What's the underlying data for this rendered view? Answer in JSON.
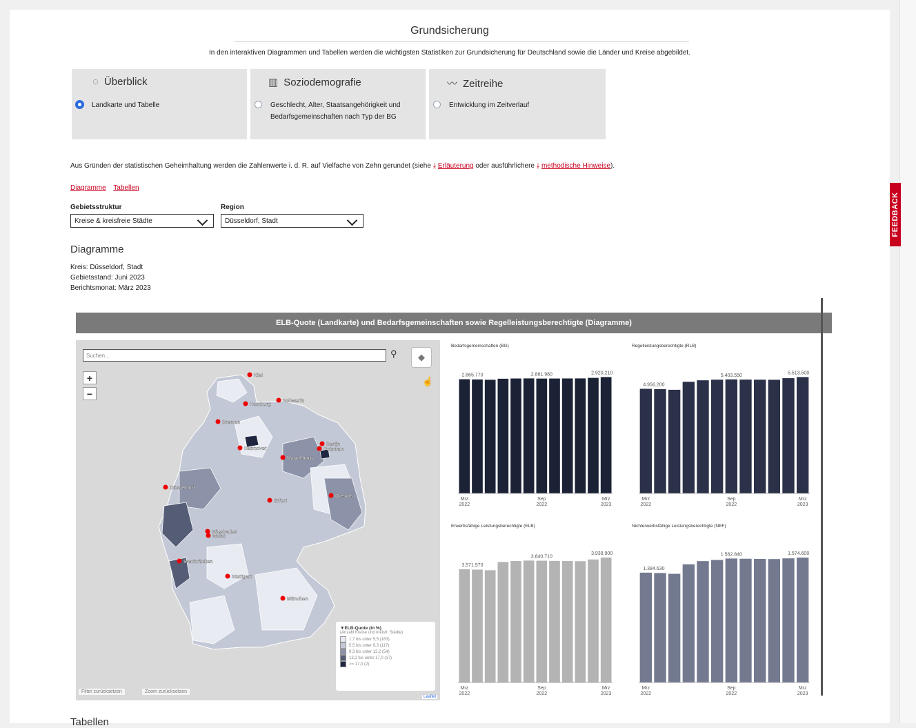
{
  "page": {
    "title": "Grundsicherung",
    "intro": "In den interaktiven Diagrammen und Tabellen werden die wichtigsten Statistiken zur Grundsicherung für Deutschland sowie die Länder und Kreise abgebildet."
  },
  "tiles": [
    {
      "title": "Überblick",
      "icon": "compass-icon",
      "option": "Landkarte und Tabelle",
      "selected": true
    },
    {
      "title": "Soziodemografie",
      "icon": "people-chart-icon",
      "option": "Geschlecht, Alter, Staatsangehörigkeit und Bedarfsgemeinschaften nach Typ der BG",
      "selected": false
    },
    {
      "title": "Zeitreihe",
      "icon": "timeseries-icon",
      "option": "Entwicklung im Zeitverlauf",
      "selected": false
    }
  ],
  "notice": {
    "text_before": "Aus Gründen der statistischen Geheimhaltung werden die Zahlenwerte i. d. R. auf Vielfache von Zehn gerundet (siehe",
    "link1": "Erläuterung",
    "text_mid": "oder ausführlichere",
    "link2": "methodische Hinweise",
    "text_after": ")."
  },
  "anchors": {
    "diagramme": "Diagramme",
    "tabellen": "Tabellen"
  },
  "filters": {
    "gebiet_label": "Gebietsstruktur",
    "gebiet_value": "Kreise & kreisfreie Städte",
    "region_label": "Region",
    "region_value": "Düsseldorf, Stadt"
  },
  "section": {
    "heading": "Diagramme",
    "kreis": "Kreis: Düsseldorf, Stadt",
    "gebietsstand": "Gebietsstand: Juni 2023",
    "berichtsmonat": "Berichtsmonat: März 2023"
  },
  "panel": {
    "title": "ELB-Quote (Landkarte) und Bedarfsgemeinschaften sowie Regelleistungsberechtigte (Diagramme)"
  },
  "map": {
    "search_placeholder": "Suchen...",
    "zoom_in": "+",
    "zoom_out": "−",
    "reset_filter": "Filter zurücksetzen",
    "reset_zoom": "Zoom zurücksetzen",
    "attribution": "Leaflet",
    "cities": [
      "Kiel",
      "Hamburg",
      "Schwerin",
      "Bremen",
      "Berlin",
      "Potsdam",
      "Hannover",
      "Magdeburg",
      "Düsseldorf",
      "Erfurt",
      "Dresden",
      "Wiesbaden",
      "Mainz",
      "Saarbrücken",
      "Stuttgart",
      "München"
    ],
    "legend": {
      "title": "ELB-Quote (in %)",
      "subtitle": "(Anzahl Kreise und kreisfr. Städte)",
      "items": [
        {
          "label": "1,7 bis unter 5,5 (163)",
          "color": "#e8ebf2"
        },
        {
          "label": "5,5 bis unter 9,3 (117)",
          "color": "#c3c8d6"
        },
        {
          "label": "9,3 bis unter 13,2 (54)",
          "color": "#8c93a8"
        },
        {
          "label": "13,2 bis unter 17,0 (17)",
          "color": "#555d76"
        },
        {
          "label": ">= 17,0 (2)",
          "color": "#1f2640"
        }
      ]
    }
  },
  "chart_data": [
    {
      "type": "bar",
      "title": "Bedarfsgemeinschaften (BG)",
      "color": "#1b2236",
      "x_ticks": [
        "Mrz 2022",
        "Sep 2022",
        "Mrz 2023"
      ],
      "values": [
        2865770,
        2860000,
        2852000,
        2878000,
        2884000,
        2886000,
        2881980,
        2883000,
        2885000,
        2886000,
        2900000,
        2920210
      ],
      "labels": [
        {
          "index": 0,
          "text": "2.865.770"
        },
        {
          "index": 6,
          "text": "2.881.980"
        },
        {
          "index": 11,
          "text": "2.920.210"
        }
      ]
    },
    {
      "type": "bar",
      "title": "Regelleistungsberechtigte (RLB)",
      "color": "#2a3148",
      "x_ticks": [
        "Mrz 2022",
        "Sep 2022",
        "Mrz 2023"
      ],
      "values": [
        4956200,
        4940000,
        4910000,
        5290000,
        5360000,
        5390000,
        5403550,
        5395000,
        5390000,
        5385000,
        5460000,
        5513500
      ],
      "labels": [
        {
          "index": 0,
          "text": "4.956.200"
        },
        {
          "index": 6,
          "text": "5.403.550"
        },
        {
          "index": 11,
          "text": "5.513.500"
        }
      ]
    },
    {
      "type": "bar",
      "title": "Erwerbsfähige Leistungsberechtigte (ELB)",
      "color": "#b3b3b3",
      "x_ticks": [
        "Mrz 2022",
        "Sep 2022",
        "Mrz 2023"
      ],
      "values": [
        3571570,
        3560000,
        3540000,
        3800000,
        3830000,
        3845000,
        3840710,
        3835000,
        3830000,
        3825000,
        3880000,
        3938900
      ],
      "labels": [
        {
          "index": 0,
          "text": "3.571.570"
        },
        {
          "index": 6,
          "text": "3.840.710"
        },
        {
          "index": 11,
          "text": "3.938.900"
        }
      ]
    },
    {
      "type": "bar",
      "title": "Nichterwerbsfähige Leistungsberechtigte (NEF)",
      "color": "#737a90",
      "x_ticks": [
        "Mrz 2022",
        "Sep 2022",
        "Mrz 2023"
      ],
      "values": [
        1384630,
        1380000,
        1370000,
        1490000,
        1530000,
        1545000,
        1562840,
        1560000,
        1558000,
        1556000,
        1565000,
        1574600
      ],
      "labels": [
        {
          "index": 0,
          "text": "1.384.630"
        },
        {
          "index": 6,
          "text": "1.562.840"
        },
        {
          "index": 11,
          "text": "1.574.600"
        }
      ]
    }
  ],
  "tables": {
    "heading": "Tabellen"
  },
  "feedback": "FEEDBACK"
}
